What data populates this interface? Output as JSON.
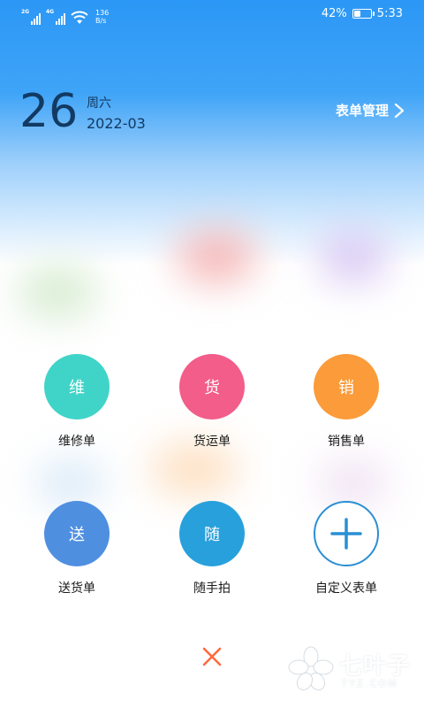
{
  "status_bar": {
    "sim1": "2G",
    "sim2": "4G",
    "net_speed_value": "136",
    "net_speed_unit": "B/s",
    "battery_percent": "42%",
    "battery_level": 0.42,
    "time": "5:33"
  },
  "header": {
    "day": "26",
    "weekday": "周六",
    "year_month": "2022-03",
    "manage_label": "表单管理"
  },
  "actions": [
    {
      "icon_text": "维",
      "label": "维修单",
      "color": "#40d4c8"
    },
    {
      "icon_text": "货",
      "label": "货运单",
      "color": "#f25d8a"
    },
    {
      "icon_text": "销",
      "label": "销售单",
      "color": "#fb9b3a"
    },
    {
      "icon_text": "送",
      "label": "送货单",
      "color": "#4f8fe0"
    },
    {
      "icon_text": "随",
      "label": "随手拍",
      "color": "#28a0db"
    },
    {
      "icon_text": "",
      "label": "自定义表单",
      "color": "#2a8fd3"
    }
  ],
  "close_color": "#ff6a3d",
  "watermark": {
    "text": "七叶子",
    "sub": "7YZ.COM"
  }
}
